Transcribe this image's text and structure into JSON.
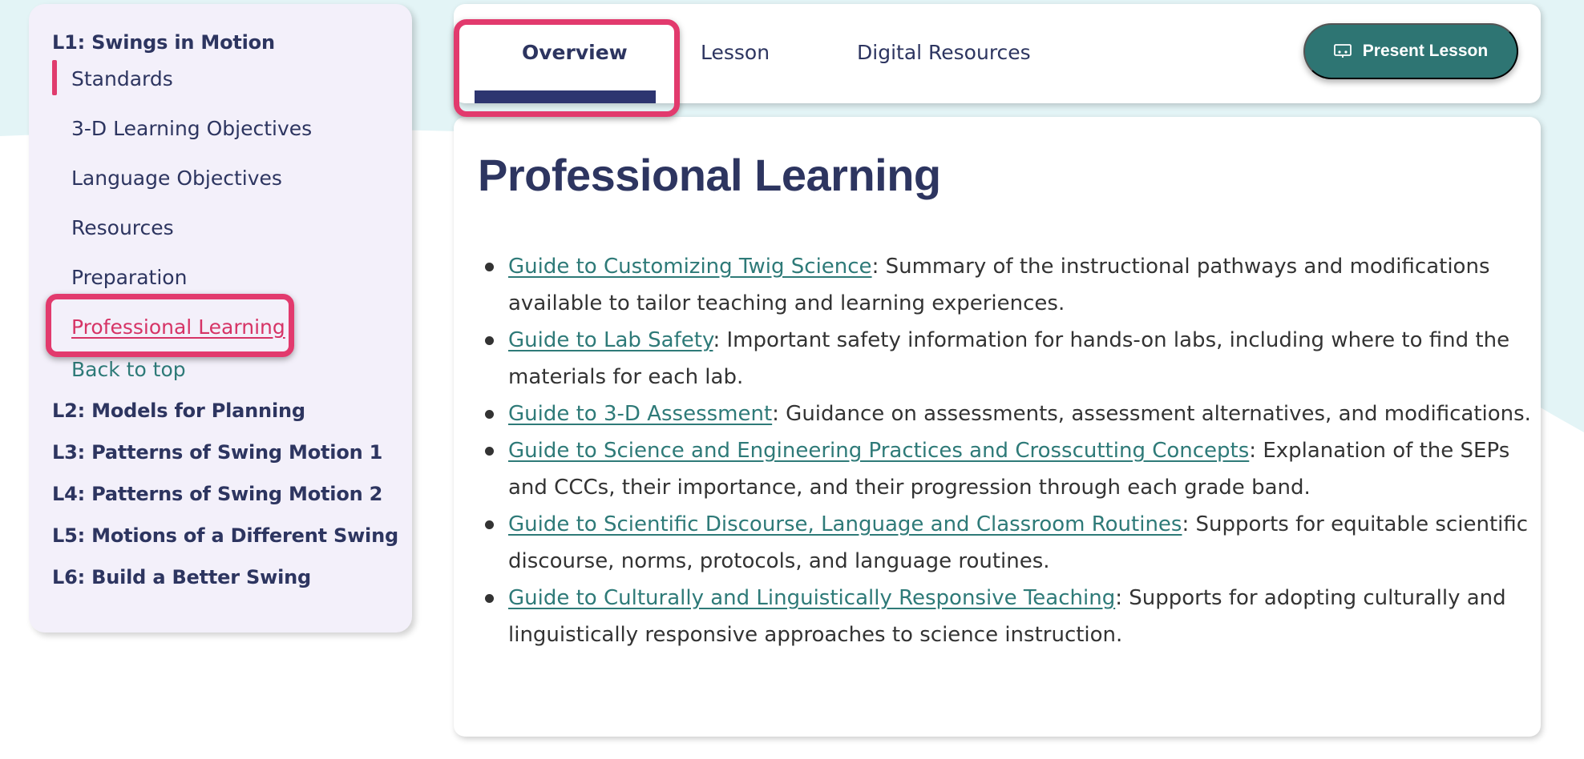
{
  "sidebar": {
    "lesson1": {
      "title": "L1: Swings in Motion",
      "items": [
        "Standards",
        "3-D Learning Objectives",
        "Language Objectives",
        "Resources",
        "Preparation"
      ],
      "active": "Professional Learning",
      "back_to_top": "Back to top"
    },
    "lessons": [
      "L2: Models for Planning",
      "L3: Patterns of Swing Motion 1",
      "L4: Patterns of Swing Motion 2",
      "L5: Motions of a Different Swing",
      "L6: Build a Better Swing"
    ]
  },
  "tabs": [
    "Overview",
    "Lesson",
    "Digital Resources"
  ],
  "present_button": {
    "label": "Present Lesson",
    "icon": "presentation-icon"
  },
  "main": {
    "title": "Professional Learning",
    "guides": [
      {
        "link": "Guide to Customizing Twig Science",
        "text": ": Summary of the instructional pathways and modifications available to tailor teaching and learning experiences."
      },
      {
        "link": "Guide to Lab Safety",
        "text": ": Important safety information for hands-on labs, including where to find the materials for each lab."
      },
      {
        "link": "Guide to 3-D Assessment",
        "text": ": Guidance on assessments, assessment alternatives, and modifications."
      },
      {
        "link": "Guide to Science and Engineering Practices and Crosscutting Concepts",
        "text": ": Explanation of the SEPs and CCCs, their importance, and their progression through each grade band."
      },
      {
        "link": "Guide to Scientific Discourse, Language and Classroom Routines",
        "text": ": Supports for equitable scientific discourse, norms, protocols, and language routines."
      },
      {
        "link": "Guide to Culturally and Linguistically Responsive Teaching",
        "text": ": Supports for adopting culturally and linguistically responsive approaches to science instruction."
      }
    ]
  },
  "colors": {
    "accent_pink": "#e23a6d",
    "teal": "#2e7573",
    "navy": "#2d3560",
    "sidebar_bg": "#f3f0fa",
    "page_bg_wave": "#e3f4f6"
  }
}
